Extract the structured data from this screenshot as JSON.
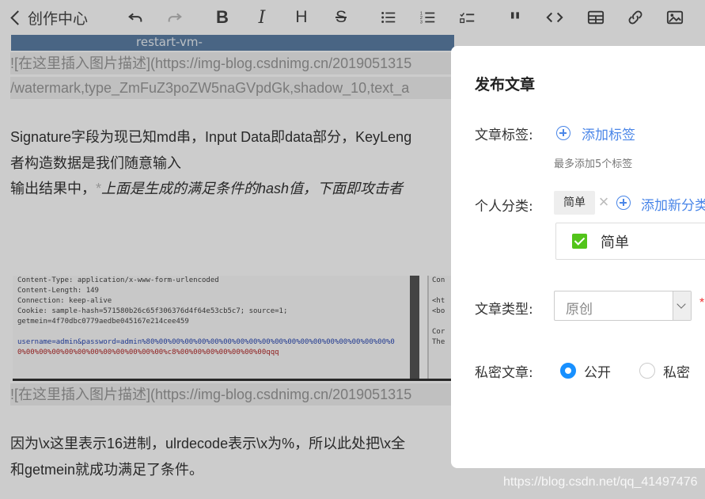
{
  "toolbar": {
    "back_label": "创作中心",
    "tools": [
      "undo-icon",
      "redo-icon",
      "bold-icon",
      "italic-icon",
      "heading-icon",
      "strikethrough-icon",
      "unordered-list-icon",
      "ordered-list-icon",
      "task-list-icon",
      "quote-icon",
      "code-icon",
      "table-icon",
      "link-icon",
      "image-icon"
    ]
  },
  "editor": {
    "image_caption_top": "restart-vm-",
    "img_line1": "![在这里插入图片描述](https://img-blog.csdnimg.cn/2019051315",
    "img_line1b": "/watermark,type_ZmFuZ3poZW5naGVpdGk,shadow_10,text_a",
    "para1_line1": "Signature字段为现已知md串，Input Data即data部分，KeyLeng",
    "para1_line2": "者构造数据是我们随意输入",
    "para2_prefix": "输出结果中，",
    "para2_star": "*",
    "para2_italic": "上面是生成的满足条件的hash值，下面即攻击者",
    "screenshot_code": [
      "Content-Type: application/x-www-form-urlencoded",
      "Content-Length: 149",
      "Connection: keep-alive",
      "Cookie: sample-hash=571580b26c65f306376d4f64e53cb5c7; source=1;",
      "getmein=4f70dbc0779aedbe045167e214cee459",
      "",
      "username=admin&password=admin%80%00%00%00%00%00%00%00%00%00%00%00%00%00%00%00%00%00%00%0",
      "0%00%00%00%00%00%00%00%00%00%00%00%c8%00%00%00%00%00%00%00qqq"
    ],
    "screenshot_code_right": [
      "Con",
      "",
      "<ht",
      "<bo",
      "",
      "Cor",
      "The"
    ],
    "img_line2": "![在这里插入图片描述](https://img-blog.csdnimg.cn/2019051315",
    "para3_line1": "因为\\x这里表示16进制，ulrdecode表示\\x为%，所以此处把\\x全",
    "para3_line2": "和getmein就成功满足了条件。"
  },
  "dialog": {
    "title": "发布文章",
    "tags_label": "文章标签:",
    "add_tag": "添加标签",
    "tag_hint": "最多添加5个标签",
    "category_label": "个人分类:",
    "category_tag": "简单",
    "add_category": "添加新分类",
    "category_option": "简单",
    "type_label": "文章类型:",
    "type_value": "原创",
    "required_mark": "*",
    "private_label": "私密文章:",
    "public_option": "公开",
    "private_option": "私密"
  },
  "watermark": "https://blog.csdn.net/qq_41497476"
}
